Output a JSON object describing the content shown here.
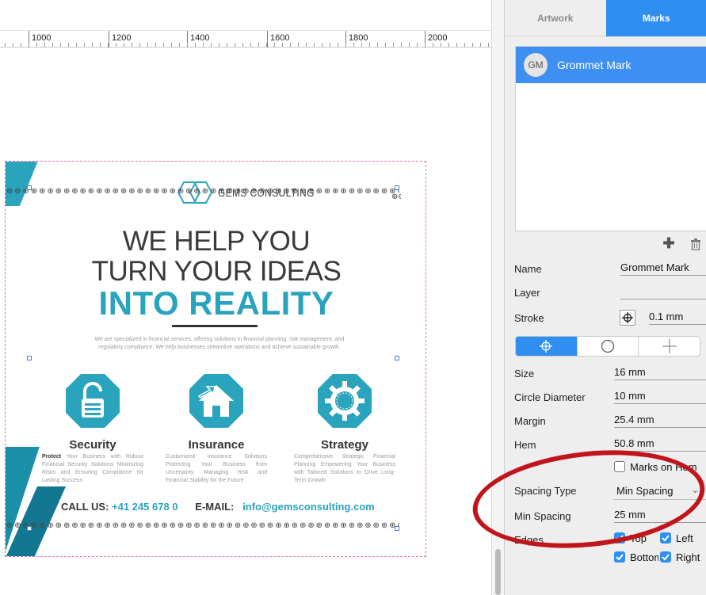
{
  "ruler": {
    "labels": [
      "1000",
      "1200",
      "1400",
      "1600",
      "1800",
      "2000"
    ]
  },
  "flyer": {
    "logo_text": "GEMS CONSULTING",
    "headline_line1": "WE HELP YOU",
    "headline_line2": "TURN YOUR IDEAS",
    "headline_line3": "INTO REALITY",
    "paragraph": "We are specialized in financial services, offering solutions in financial planning, risk management, and regulatory compliance. We help businesses streamline operations and achieve sustainable growth.",
    "services": [
      {
        "title": "Security",
        "lead": "Protect",
        "text": " Your Business with Robust Financial Security Solutions Minimizing Risks and Ensuring Compliance for Lasting Success",
        "icon": "lock-icon"
      },
      {
        "title": "Insurance",
        "lead": "",
        "text": "Customized Insurance Solutions Protecting Your Business from Uncertainty, Managing Risk and Financial Stability for the Future",
        "icon": "house-icon"
      },
      {
        "title": "Strategy",
        "lead": "",
        "text": "Comprehensive Strategic Financial Planning Empowering Your Business with Tailored Solutions to Drive Long-Term Growth",
        "icon": "gear-icon"
      }
    ],
    "call_label": "CALL US:",
    "call_value": "+41 245 678 0",
    "email_label": "E-MAIL:",
    "email_value": "info@gemsconsulting.com"
  },
  "panel": {
    "tabs": [
      "Artwork",
      "Marks"
    ],
    "active_tab": "Marks",
    "marks": [
      {
        "initials": "GM",
        "name": "Grommet Mark"
      }
    ],
    "fields": {
      "name_label": "Name",
      "name_value": "Grommet Mark",
      "layer_label": "Layer",
      "layer_value": "",
      "stroke_label": "Stroke",
      "stroke_value": "0.1 mm",
      "size_label": "Size",
      "size_value": "16 mm",
      "circle_label": "Circle Diameter",
      "circle_value": "10 mm",
      "margin_label": "Margin",
      "margin_value": "25.4 mm",
      "hem_label": "Hem",
      "hem_value": "50.8 mm",
      "marks_on_hem_label": "Marks on Hem",
      "marks_on_hem_checked": false,
      "spacing_type_label": "Spacing Type",
      "spacing_type_value": "Min Spacing",
      "min_spacing_label": "Min Spacing",
      "min_spacing_value": "25 mm",
      "edges_label": "Edges",
      "edges": [
        {
          "label": "Top",
          "checked": true
        },
        {
          "label": "Left",
          "checked": true
        },
        {
          "label": "Bottom",
          "checked": true
        },
        {
          "label": "Right",
          "checked": true
        }
      ]
    },
    "shape_options": [
      "crosshair-circle",
      "circle",
      "cross"
    ],
    "selected_shape": "crosshair-circle"
  },
  "colors": {
    "accent": "#2f8ff0",
    "flyer_teal": "#2aa3bd",
    "annotation_red": "#c0151a"
  }
}
